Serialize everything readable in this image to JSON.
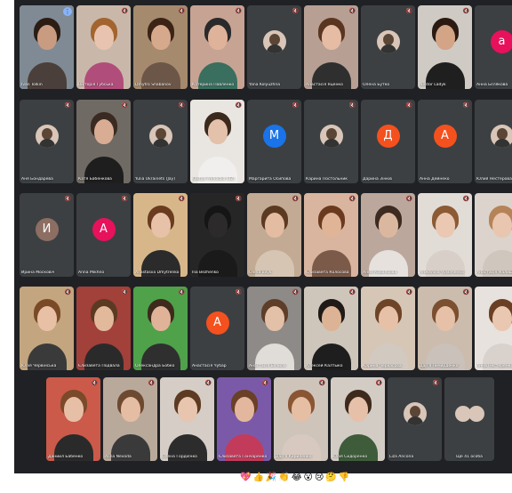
{
  "participants": [
    {
      "name": "Ivan Tolkin",
      "kind": "video",
      "selected": true,
      "pin": true,
      "skin": "#c99c82",
      "hair": "#2b1d14",
      "shirt": "#4a3f3a",
      "bg": "#7f8a94"
    },
    {
      "name": "Вікторія Губська",
      "kind": "video",
      "skin": "#e8c4b0",
      "hair": "#a3642f",
      "shirt": "#b14d7a",
      "bg": "#c9b8aa"
    },
    {
      "name": "Dmytro Shabanov",
      "kind": "video",
      "skin": "#d7a98c",
      "hair": "#3b2416",
      "shirt": "#6c5648",
      "bg": "#a58a6e"
    },
    {
      "name": "Катерина Павленко",
      "kind": "video",
      "skin": "#dfb39a",
      "hair": "#2a2a2a",
      "shirt": "#3a6e5e",
      "bg": "#c7a393"
    },
    {
      "name": "Yana Kolyuzhna",
      "kind": "avatar",
      "style": "photo"
    },
    {
      "name": "Анастасія Яценко",
      "kind": "video",
      "skin": "#e6bca4",
      "hair": "#5a3620",
      "shirt": "#2f2f2f",
      "bg": "#b79f93"
    },
    {
      "name": "Олена Бутко",
      "kind": "avatar",
      "style": "photo"
    },
    {
      "name": "Nestor Ladyk",
      "kind": "video",
      "skin": "#d3a486",
      "hair": "#2b1a12",
      "shirt": "#1f1f1f",
      "bg": "#cfcac4"
    },
    {
      "name": "Анна Бєлякова",
      "kind": "avatar",
      "letter": "a",
      "color": "#e8115b"
    },
    {
      "name": "Аня Бондарева",
      "kind": "avatar",
      "style": "photo"
    },
    {
      "name": "Катя Бабенкова",
      "kind": "video",
      "skin": "#d8ad93",
      "hair": "#3a2a22",
      "shirt": "#1e1e1e",
      "bg": "#6f6a63"
    },
    {
      "name": "Yulia Ukrainets (Jay)",
      "kind": "avatar",
      "style": "photo"
    },
    {
      "name": "Kostya Pryhodko (32)",
      "kind": "video",
      "skin": "#e3c1aa",
      "hair": "#3b2a1c",
      "shirt": "#f1efed",
      "bg": "#e9e6e2"
    },
    {
      "name": "Маргарита Осипова",
      "kind": "avatar",
      "letter": "M",
      "color": "#1a73e8"
    },
    {
      "name": "Карина Постольник",
      "kind": "avatar",
      "style": "photo"
    },
    {
      "name": "Дарина Зінків",
      "kind": "avatar",
      "letter": "Д",
      "color": "#f4511e"
    },
    {
      "name": "Анна Дейнеко",
      "kind": "avatar",
      "letter": "A",
      "color": "#f4511e"
    },
    {
      "name": "Юлия Нестерова",
      "kind": "avatar",
      "style": "photo"
    },
    {
      "name": "Ирина Московіч",
      "kind": "avatar",
      "letter": "И",
      "color": "#8d6e63"
    },
    {
      "name": "Anna Mikhno",
      "kind": "avatar",
      "letter": "A",
      "color": "#e8115b"
    },
    {
      "name": "Anastasiia Dmytrenko",
      "kind": "video",
      "skin": "#e7c2a8",
      "hair": "#6a3b1f",
      "shirt": "#2b2b2b",
      "bg": "#d7b78a"
    },
    {
      "name": "Ilia Bezhenko",
      "kind": "video",
      "skin": "#2c2a2a",
      "hair": "#151515",
      "shirt": "#1a1a1a",
      "bg": "#272626"
    },
    {
      "name": "Olena Bilyk",
      "kind": "video",
      "skin": "#e4bca2",
      "hair": "#5c3a22",
      "shirt": "#d6c5b3",
      "bg": "#c2aa94"
    },
    {
      "name": "Єлизавета Колосова",
      "kind": "video",
      "skin": "#e0b497",
      "hair": "#6b3a1e",
      "shirt": "#7b5a49",
      "bg": "#d9b59f"
    },
    {
      "name": "Анна Ковальова",
      "kind": "video",
      "skin": "#dcb7a0",
      "hair": "#3d2a20",
      "shirt": "#e6e1dd",
      "bg": "#bba79c"
    },
    {
      "name": "Анжеліна Чумаченко",
      "kind": "video",
      "skin": "#eac8b2",
      "hair": "#8c5a33",
      "shirt": "#d8cfc8",
      "bg": "#e2dcd7"
    },
    {
      "name": "Анастасія Малишко",
      "kind": "video",
      "skin": "#e8c6b0",
      "hair": "#b58357",
      "shirt": "#cfc6bd",
      "bg": "#dcd3cc"
    },
    {
      "name": "Юлія Червінська",
      "kind": "video",
      "skin": "#e7c0a5",
      "hair": "#7a4a26",
      "shirt": "#3a3a3a",
      "bg": "#c3a57f"
    },
    {
      "name": "Єлизавета Подвала",
      "kind": "video",
      "skin": "#e3b99c",
      "hair": "#5b3a23",
      "shirt": "#2a2a2a",
      "bg": "#a2403a"
    },
    {
      "name": "Олександра Бобко",
      "kind": "video",
      "skin": "#e0b398",
      "hair": "#3d2a1d",
      "shirt": "#2f2f2f",
      "bg": "#4fa14a"
    },
    {
      "name": "Анастасія Чубар",
      "kind": "avatar",
      "letter": "A",
      "color": "#f4511e"
    },
    {
      "name": "Анастасія Бочило",
      "kind": "video",
      "skin": "#e3c0a8",
      "hair": "#5e3e29",
      "shirt": "#e0dcd8",
      "bg": "#8d8a87"
    },
    {
      "name": "Алексей Калтыко",
      "kind": "video",
      "skin": "#ddb395",
      "hair": "#1f1a17",
      "shirt": "#1e1e1e",
      "bg": "#cfc6bb"
    },
    {
      "name": "Карина Черкасова",
      "kind": "video",
      "skin": "#e7c0a8",
      "hair": "#6e4427",
      "shirt": "#d2c9c1",
      "bg": "#d6c6b6"
    },
    {
      "name": "Дар'я Ничирденко",
      "kind": "video",
      "skin": "#e6c1a7",
      "hair": "#7b4f2f",
      "shirt": "#c9c1ba",
      "bg": "#cbbcae"
    },
    {
      "name": "Анна Нестеренко",
      "kind": "video",
      "skin": "#e9c7b0",
      "hair": "#6b3f24",
      "shirt": "#d9d2cc",
      "bg": "#e7e2dd"
    },
    {
      "name": "Даниил Бабенко",
      "kind": "video",
      "skin": "#e6bfa6",
      "hair": "#7a4a2a",
      "shirt": "#2a2a2a",
      "bg": "#cb5a4a"
    },
    {
      "name": "Alina Nevoda",
      "kind": "video",
      "skin": "#e4bda3",
      "hair": "#6d4930",
      "shirt": "#3a3a3a",
      "bg": "#b9a99a"
    },
    {
      "name": "Олена Гордієнко",
      "kind": "video",
      "skin": "#e8c5ae",
      "hair": "#5d3a22",
      "shirt": "#2c2c2c",
      "bg": "#d5cdc6"
    },
    {
      "name": "Єлизавета Гончаренко",
      "kind": "video",
      "skin": "#e2b79d",
      "hair": "#6a4026",
      "shirt": "#c23b5b",
      "bg": "#7a5aa8"
    },
    {
      "name": "Дар'я Кириленко",
      "kind": "video",
      "skin": "#e5bea4",
      "hair": "#8a5533",
      "shirt": "#d7c9bf",
      "bg": "#cfc4ba"
    },
    {
      "name": "Юлія Сидоренко",
      "kind": "video",
      "skin": "#e6c0a8",
      "hair": "#3e2a1c",
      "shirt": "#3e5c3a",
      "bg": "#d3ccc5"
    },
    {
      "name": "Liza Ancona",
      "kind": "avatar",
      "style": "photo"
    },
    {
      "name": "Ще 41 особа",
      "kind": "more"
    }
  ],
  "reactions": [
    "💖",
    "👍",
    "🎉",
    "👏",
    "😂",
    "😮",
    "😢",
    "🤔",
    "👎"
  ],
  "colors": {
    "screen": "#202124",
    "tile": "#3c4043",
    "accent": "#8ab4f8"
  }
}
